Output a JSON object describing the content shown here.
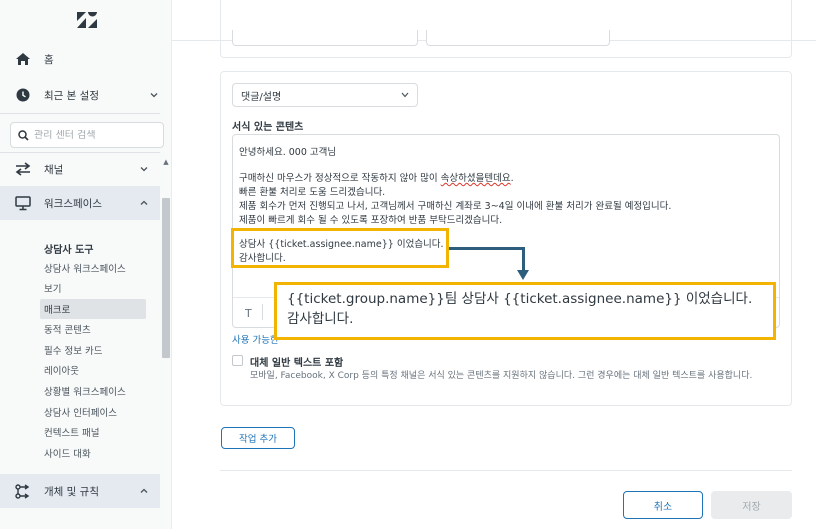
{
  "sidebar": {
    "home_label": "홈",
    "recent_label": "최근 본 설정",
    "search_placeholder": "관리 센터 검색",
    "channel_label": "채널",
    "workspace_label": "워크스페이스",
    "agent_tools_title": "상담사 도구",
    "sub_items": [
      "상담사 워크스페이스",
      "보기",
      "매크로",
      "동적 콘텐츠",
      "필수 정보 카드",
      "레이아웃",
      "상황별 워크스페이스",
      "상담사 인터페이스",
      "컨텍스트 패널",
      "사이드 대화"
    ],
    "active_item": "매크로",
    "objects_label": "개체 및 규칙"
  },
  "action": {
    "dropdown_value": "댓글/설명",
    "rich_content_label": "서식 있는 콘텐츠",
    "editor_lines": {
      "greeting": "안녕하세요. 000 고객님",
      "l1_pre": "구매하신 마우스가 정상적으로 작동하지 않아 많이 ",
      "l1_err": "속상하셨을텐데요",
      "l1_post": ".",
      "l2": "빠른 환불 처리로 도움 드리겠습니다.",
      "l3": "제품 회수가 먼저 진행되고 나서, 고객님께서 구매하신 계좌로 3~4일 이내에 환불 처리가 완료될 예정입니다.",
      "l4": "제품이 빠르게 회수 될 수 있도록 포장하여 반품 부탁드리겠습니다.",
      "l5": "상담사 {{ticket.assignee.name}} 이었습니다.",
      "l6": "감사합니다."
    },
    "toolbar_t": "T",
    "usage_link": "사용 가능한",
    "plain_text_label": "대체 일반 텍스트 포함",
    "plain_text_desc": "모바일, Facebook, X Corp 등의 특정 채널은 서식 있는 콘텐츠를 지원하지 않습니다. 그런 경우에는 대체 일반 텍스트를 사용합니다."
  },
  "annotation": {
    "line1": "{{ticket.group.name}}팀 상담사 {{ticket.assignee.name}} 이었습니다.",
    "line2": "감사합니다.",
    "box_color": "#f2b400",
    "arrow_color": "#2e5e7d"
  },
  "buttons": {
    "add_action": "작업 추가",
    "cancel": "취소",
    "save": "저장"
  },
  "colors": {
    "accent": "#1f73b7",
    "sidebar_bg": "#f8f9f9",
    "active_bg": "#e4eaef"
  }
}
